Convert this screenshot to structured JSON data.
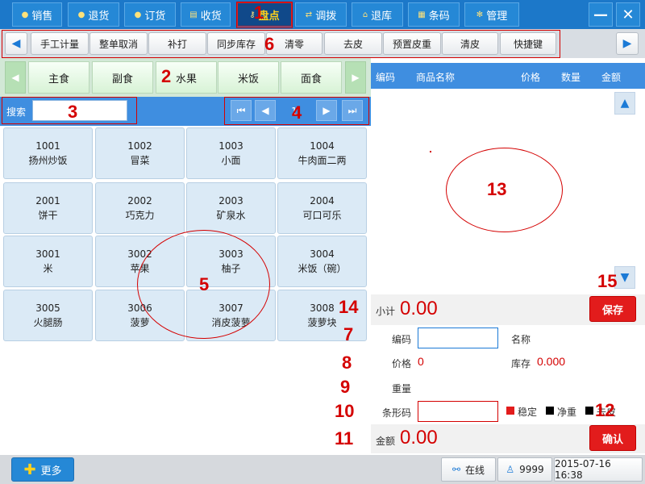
{
  "nav": {
    "tabs": [
      {
        "label": "销售",
        "icon": "dot-icon"
      },
      {
        "label": "退货",
        "icon": "dot-icon"
      },
      {
        "label": "订货",
        "icon": "dot-icon"
      },
      {
        "label": "收货",
        "icon": "document-icon"
      },
      {
        "label": "盘点",
        "icon": "key-icon",
        "active": true
      },
      {
        "label": "调拨",
        "icon": "transfer-icon"
      },
      {
        "label": "退库",
        "icon": "home-icon"
      },
      {
        "label": "条码",
        "icon": "grid-icon"
      },
      {
        "label": "管理",
        "icon": "gear-icon"
      }
    ],
    "minimize": "—",
    "close": "✕"
  },
  "functions": {
    "buttons": [
      "手工计量",
      "整单取消",
      "补打",
      "同步库存",
      "清零",
      "去皮",
      "预置皮重",
      "清皮",
      "快捷键"
    ]
  },
  "categories": {
    "items": [
      "主食",
      "副食",
      "水果",
      "米饭",
      "面食"
    ]
  },
  "search": {
    "label": "搜索",
    "value": "",
    "page": "1"
  },
  "products": [
    {
      "code": "1001",
      "name": "扬州炒饭"
    },
    {
      "code": "1002",
      "name": "冒菜"
    },
    {
      "code": "1003",
      "name": "小面"
    },
    {
      "code": "1004",
      "name": "牛肉面二两"
    },
    {
      "code": "2001",
      "name": "饼干"
    },
    {
      "code": "2002",
      "name": "巧克力"
    },
    {
      "code": "2003",
      "name": "矿泉水"
    },
    {
      "code": "2004",
      "name": "可口可乐"
    },
    {
      "code": "3001",
      "name": "米"
    },
    {
      "code": "3002",
      "name": "苹果"
    },
    {
      "code": "3003",
      "name": "柚子"
    },
    {
      "code": "3004",
      "name": "米饭（碗）"
    },
    {
      "code": "3005",
      "name": "火腿肠"
    },
    {
      "code": "3006",
      "name": "菠萝"
    },
    {
      "code": "3007",
      "name": "消皮菠萝"
    },
    {
      "code": "3008",
      "name": "菠萝块"
    }
  ],
  "table": {
    "headers": [
      "编码",
      "商品名称",
      "价格",
      "数量",
      "金额"
    ]
  },
  "subtotal": {
    "label": "小计",
    "value": "0.00",
    "save_label": "保存"
  },
  "form": {
    "code_label": "编码",
    "code_value": "",
    "name_label": "名称",
    "name_value": "",
    "price_label": "价格",
    "price_value": "0",
    "stock_label": "库存",
    "stock_value": "0.000",
    "weight_label": "重量",
    "barcode_label": "条形码",
    "barcode_value": "",
    "stable_label": "稳定",
    "net_label": "净重",
    "tare_label": "去皮",
    "stable_color": "#e21c1c",
    "net_color": "#000000",
    "tare_color": "#000000"
  },
  "amount": {
    "label": "金额",
    "value": "0.00",
    "confirm_label": "确认"
  },
  "status": {
    "more_label": "更多",
    "online_label": "在线",
    "user": "9999",
    "datetime": "2015-07-16 16:38"
  },
  "annotations": [
    "1",
    "2",
    "3",
    "4",
    "5",
    "6",
    "7",
    "8",
    "9",
    "10",
    "11",
    "12",
    "13",
    "14",
    "15"
  ]
}
